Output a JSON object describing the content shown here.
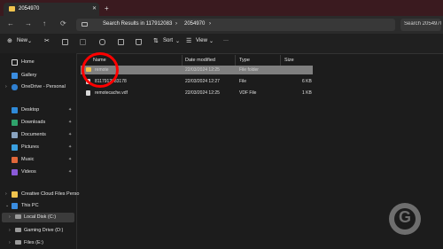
{
  "window": {
    "tab_title": "2054970",
    "close_glyph": "✕",
    "new_tab_glyph": "+"
  },
  "address": {
    "nav_glyphs": [
      "←",
      "→",
      "↑",
      "⟳"
    ],
    "crumbs": [
      "Search Results in 117912083",
      "›",
      "2054970",
      "›"
    ],
    "search_placeholder": "Search 2054970"
  },
  "toolbar": {
    "new_label": "New",
    "sort_label": "Sort",
    "view_label": "View",
    "more_label": "···"
  },
  "sidebar": {
    "items": [
      {
        "label": "Home"
      },
      {
        "label": "Gallery"
      },
      {
        "label": "OneDrive - Personal"
      },
      {
        "label": "Desktop"
      },
      {
        "label": "Downloads"
      },
      {
        "label": "Documents"
      },
      {
        "label": "Pictures"
      },
      {
        "label": "Music"
      },
      {
        "label": "Videos"
      },
      {
        "label": "Creative Cloud Files Perso"
      },
      {
        "label": "This PC"
      },
      {
        "label": "Local Disk (C:)"
      },
      {
        "label": "Gaming Drive (D:)"
      },
      {
        "label": "Files (E:)"
      }
    ],
    "pin_glyph": "✦",
    "chevron_right": "›",
    "chevron_down": "⌄"
  },
  "file_list": {
    "columns": [
      "Name",
      "Date modified",
      "Type",
      "Size"
    ],
    "rows": [
      {
        "name": "remote",
        "date": "22/03/2024 12:25",
        "type": "File folder",
        "size": ""
      },
      {
        "name": "8117912083178",
        "date": "22/03/2024 12:27",
        "type": "File",
        "size": "6 KB"
      },
      {
        "name": "remotecache.vdf",
        "date": "22/03/2024 12:25",
        "type": "VDF File",
        "size": "1 KB"
      }
    ]
  },
  "colors": {
    "title_bar": "#3a1a1f",
    "folder_yellow": "#f0c34e",
    "highlight_circle": "#ff0000",
    "selected_row": "#7f7f7f"
  }
}
